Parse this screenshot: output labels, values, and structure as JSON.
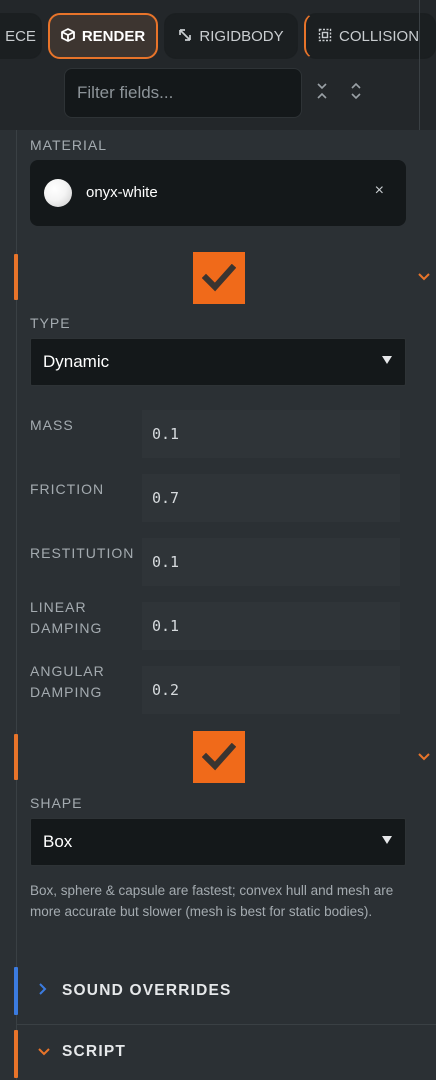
{
  "tabs": [
    {
      "label": "ECE",
      "icon": "none"
    },
    {
      "label": "RENDER",
      "icon": "cube-icon"
    },
    {
      "label": "RIGIDBODY",
      "icon": "resize-icon"
    },
    {
      "label": "COLLISION",
      "icon": "collision-icon"
    }
  ],
  "filter": {
    "placeholder": "Filter fields..."
  },
  "material": {
    "label": "MATERIAL",
    "name": "onyx-white",
    "clear": "×"
  },
  "rigidbody": {
    "enabled": true,
    "type_label": "TYPE",
    "type_value": "Dynamic",
    "fields": [
      {
        "label": "MASS",
        "value": "0.1"
      },
      {
        "label": "FRICTION",
        "value": "0.7"
      },
      {
        "label": "RESTITUTION",
        "value": "0.1"
      },
      {
        "label_line1": "LINEAR",
        "label_line2": "DAMPING",
        "value": "0.1"
      },
      {
        "label_line1": "ANGULAR",
        "label_line2": "DAMPING",
        "value": "0.2"
      }
    ]
  },
  "collision": {
    "enabled": true,
    "shape_label": "SHAPE",
    "shape_value": "Box",
    "help": "Box, sphere & capsule are fastest; convex hull and mesh are more accurate but slower (mesh is best for static bodies)."
  },
  "sections": {
    "sound_overrides": "SOUND OVERRIDES",
    "script": "SCRIPT"
  },
  "colors": {
    "accent": "#e8742a",
    "checkbox": "#f06a1a",
    "link_blue": "#3b7be0",
    "panel": "#2b3034",
    "input": "#14181a"
  }
}
